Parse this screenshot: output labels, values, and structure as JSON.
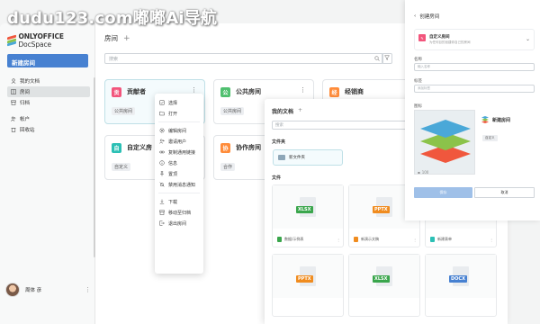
{
  "watermark": "dudu123.com嘟嘟Ai导航",
  "logo": {
    "brand": "ONLYOFFICE",
    "product": " DocSpace"
  },
  "sidebar": {
    "new_room": "新建房间",
    "items": [
      {
        "label": "我的文档",
        "icon": "person-icon"
      },
      {
        "label": "房间",
        "icon": "rooms-icon",
        "active": true
      },
      {
        "label": "归档",
        "icon": "archive-icon"
      },
      {
        "label": "帐户",
        "icon": "accounts-icon"
      },
      {
        "label": "回收站",
        "icon": "trash-icon"
      }
    ],
    "user_name": "周体 彦"
  },
  "main": {
    "crumb": "房间",
    "search_placeholder": "搜索",
    "cards": [
      {
        "badge": "贡",
        "title": "贡献者",
        "tag": "公共房间",
        "color": "#f2557c"
      },
      {
        "badge": "公",
        "title": "公共房间",
        "tag": "公共房间",
        "color": "#4fc06f"
      },
      {
        "badge": "经",
        "title": "经销商",
        "tag": "",
        "color": "#ff8c3a"
      },
      {
        "badge": "自",
        "title": "自定义房",
        "tag": "自定义",
        "color": "#2cc0b5"
      },
      {
        "badge": "协",
        "title": "协作房间",
        "tag": "合作",
        "color": "#ff8c3a"
      }
    ]
  },
  "context_menu": [
    {
      "label": "选择",
      "icon": "select-icon"
    },
    {
      "label": "打开",
      "icon": "folder-icon"
    },
    {
      "sep": true
    },
    {
      "label": "编辑房间",
      "icon": "gear-icon"
    },
    {
      "label": "邀请用户",
      "icon": "invite-icon"
    },
    {
      "label": "复制通用链接",
      "icon": "link-icon"
    },
    {
      "label": "信息",
      "icon": "info-icon"
    },
    {
      "label": "置顶",
      "icon": "pin-icon"
    },
    {
      "label": "禁用消息通知",
      "icon": "bell-off-icon"
    },
    {
      "sep": true
    },
    {
      "label": "下载",
      "icon": "download-icon"
    },
    {
      "label": "移动至归档",
      "icon": "archive-icon"
    },
    {
      "label": "退出房间",
      "icon": "exit-icon"
    }
  ],
  "docs_panel": {
    "title": "我的文档",
    "search_placeholder": "搜索",
    "folders_label": "文件夹",
    "folder_name": "新文件夹",
    "files_label": "文件",
    "files": [
      {
        "type": "XLSX",
        "name": "数据/示例表",
        "color": "#3aa64c"
      },
      {
        "type": "PPTX",
        "name": "新演示文稿",
        "color": "#f08c1f"
      },
      {
        "type": "",
        "name": "新建表单",
        "color": "#2cc0b5"
      },
      {
        "type": "PPTX",
        "name": "",
        "color": "#f08c1f"
      },
      {
        "type": "XLSX",
        "name": "",
        "color": "#3aa64c"
      },
      {
        "type": "DOCX",
        "name": "",
        "color": "#4781d1"
      }
    ]
  },
  "room_panel": {
    "title": "创建房间",
    "type_title": "自定义房间",
    "type_desc": "为任何目的创建你自己的房间",
    "name_label": "名称",
    "name_placeholder": "输入名称",
    "tags_label": "标签",
    "tags_placeholder": "添加标签",
    "icon_label": "图标",
    "preview_name": "新建房间",
    "preview_tag": "自定义",
    "handle_label": "100",
    "save": "保存",
    "cancel": "取消"
  }
}
